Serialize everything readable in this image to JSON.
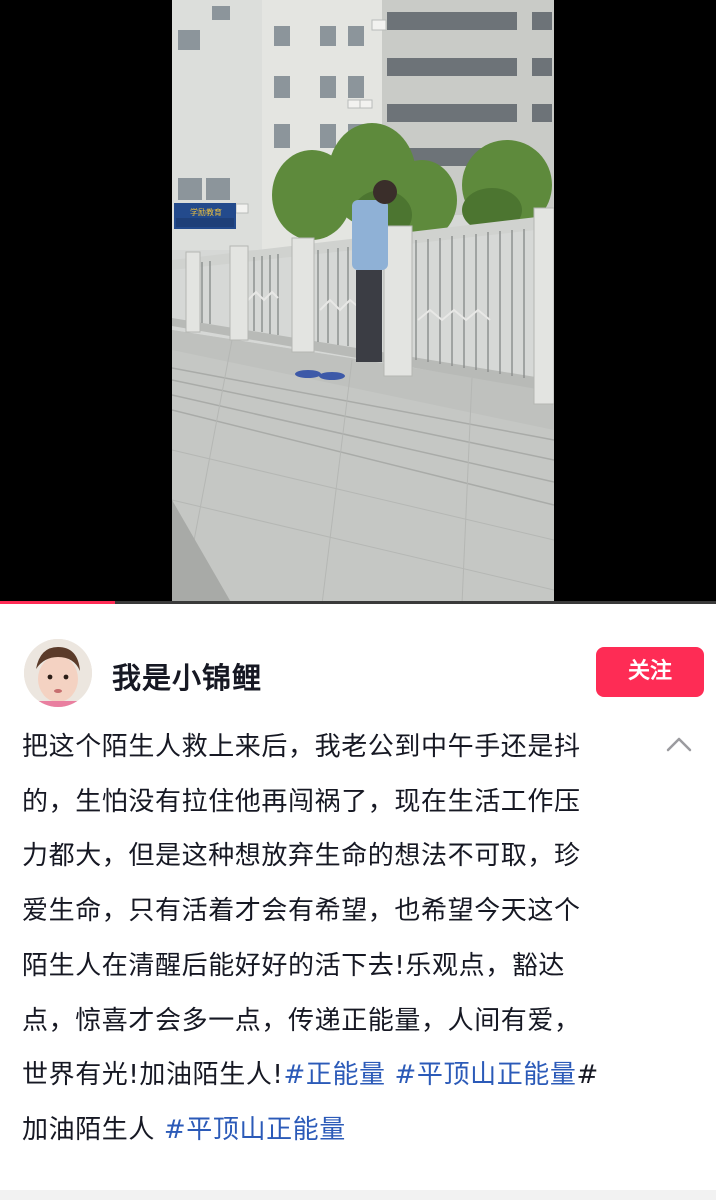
{
  "video": {
    "scene_sign_text": "学励教育",
    "progress_percent": 16
  },
  "author": {
    "name": "我是小锦鲤"
  },
  "follow": {
    "label": "关注"
  },
  "caption": {
    "line1": "把这个陌生人救上来后，我老公到中午手还是抖",
    "line2": "的，生怕没有拉住他再闯祸了，现在生活工作压",
    "line3": "力都大，但是这种想放弃生命的想法不可取，珍",
    "line4": "爱生命，只有活着才会有希望，也希望今天这个",
    "line5": "陌生人在清醒后能好好的活下去!乐观点，豁达",
    "line6": "点，惊喜才会多一点，传递正能量，人间有爱，",
    "line7_text": "世界有光!加油陌生人!",
    "hashtag1": "#正能量",
    "hashtag2": "#平顶山正能量",
    "hash_symbol": "#",
    "line8_text": "加油陌生人",
    "hashtag3": "#平顶山正能量"
  },
  "icons": {
    "collapse": "chevron-up-icon",
    "avatar": "avatar"
  },
  "colors": {
    "accent": "#fe2c55",
    "hashtag": "#2b5ab8",
    "text": "#161823"
  }
}
